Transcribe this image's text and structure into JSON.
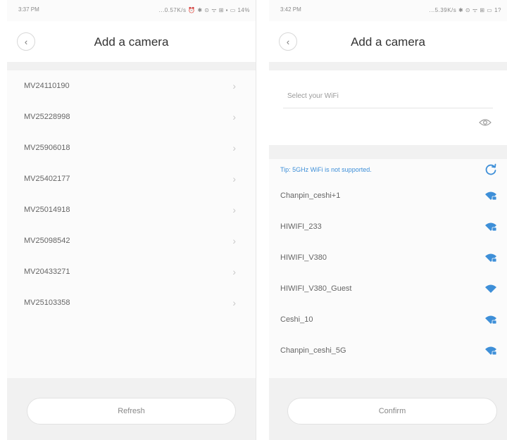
{
  "left": {
    "status": {
      "time": "3:37 PM",
      "icons": "...0.57K/s ⏰ ✱ ⊙ ᯤ ⊞ ▪ ▭ 14%"
    },
    "title": "Add a camera",
    "cameras": [
      {
        "name": "MV24110190"
      },
      {
        "name": "MV25228998"
      },
      {
        "name": "MV25906018"
      },
      {
        "name": "MV25402177"
      },
      {
        "name": "MV25014918"
      },
      {
        "name": "MV25098542"
      },
      {
        "name": "MV20433271"
      },
      {
        "name": "MV25103358"
      }
    ],
    "refresh_label": "Refresh"
  },
  "right": {
    "status": {
      "time": "3:42 PM",
      "icons": "...5.39K/s ✱ ⊙ ᯤ ⊞ ▭ 1?"
    },
    "title": "Add a camera",
    "wifi_placeholder": "Select your WiFi",
    "tip": "Tip: 5GHz WiFi is not supported.",
    "networks": [
      {
        "name": "Chanpin_ceshi+1",
        "locked": true
      },
      {
        "name": "HIWIFI_233",
        "locked": true
      },
      {
        "name": "HIWIFI_V380",
        "locked": true
      },
      {
        "name": "HIWIFI_V380_Guest",
        "locked": false
      },
      {
        "name": "Ceshi_10",
        "locked": true
      },
      {
        "name": "Chanpin_ceshi_5G",
        "locked": true
      }
    ],
    "confirm_label": "Confirm"
  },
  "colors": {
    "accent": "#3e8fd8",
    "background": "#f1f1f1"
  }
}
